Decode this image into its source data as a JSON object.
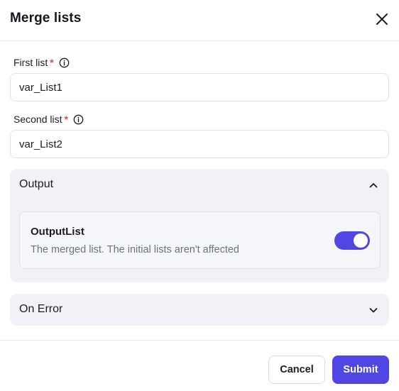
{
  "dialog": {
    "title": "Merge lists"
  },
  "fields": {
    "first_list": {
      "label": "First list",
      "required_mark": "*",
      "value": "var_List1"
    },
    "second_list": {
      "label": "Second list",
      "required_mark": "*",
      "value": "var_List2"
    }
  },
  "output_section": {
    "title": "Output",
    "expanded": true,
    "variable": {
      "name": "OutputList",
      "description": "The merged list. The initial lists aren't affected",
      "enabled": true
    }
  },
  "error_section": {
    "title": "On Error",
    "expanded": false
  },
  "footer": {
    "cancel_label": "Cancel",
    "submit_label": "Submit"
  },
  "icons": {
    "close": "close-icon",
    "info": "info-icon",
    "chevron_up": "chevron-up-icon",
    "chevron_down": "chevron-down-icon"
  },
  "colors": {
    "accent": "#5046e4",
    "required": "#e5484d",
    "section_bg": "#f0f2f6"
  }
}
